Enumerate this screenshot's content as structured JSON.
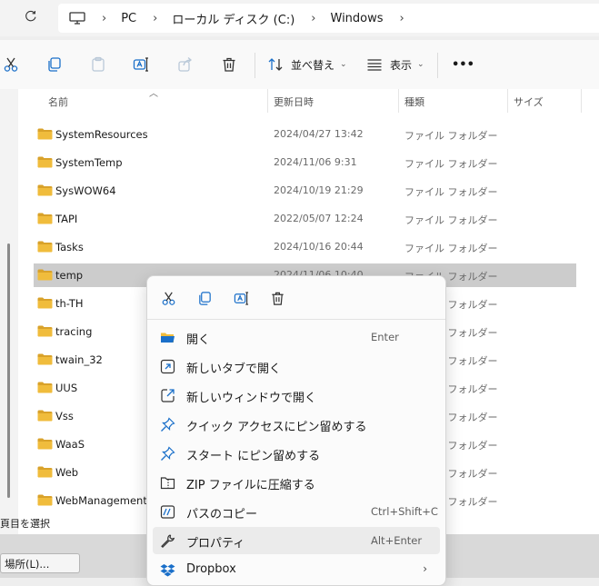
{
  "address": {
    "segments": [
      "PC",
      "ローカル ディスク (C:)",
      "Windows"
    ]
  },
  "toolbar": {
    "sort_label": "並べ替え",
    "view_label": "表示",
    "more_label": "•••"
  },
  "columns": {
    "name": "名前",
    "date": "更新日時",
    "type": "種類",
    "size": "サイズ"
  },
  "rows": [
    {
      "name": "SystemResources",
      "date": "2024/04/27 13:42",
      "type": "ファイル フォルダー"
    },
    {
      "name": "SystemTemp",
      "date": "2024/11/06 9:31",
      "type": "ファイル フォルダー"
    },
    {
      "name": "SysWOW64",
      "date": "2024/10/19 21:29",
      "type": "ファイル フォルダー"
    },
    {
      "name": "TAPI",
      "date": "2022/05/07 12:24",
      "type": "ファイル フォルダー"
    },
    {
      "name": "Tasks",
      "date": "2024/10/16 20:44",
      "type": "ファイル フォルダー"
    },
    {
      "name": "temp",
      "date": "2024/11/06 10:40",
      "type": "ファイル フォルダー"
    },
    {
      "name": "th-TH",
      "date": "",
      "type": "ファイル フォルダー"
    },
    {
      "name": "tracing",
      "date": "",
      "type": "ファイル フォルダー"
    },
    {
      "name": "twain_32",
      "date": "",
      "type": "ファイル フォルダー"
    },
    {
      "name": "UUS",
      "date": "",
      "type": "ファイル フォルダー"
    },
    {
      "name": "Vss",
      "date": "",
      "type": "ファイル フォルダー"
    },
    {
      "name": "WaaS",
      "date": "",
      "type": "ファイル フォルダー"
    },
    {
      "name": "Web",
      "date": "",
      "type": "ファイル フォルダー"
    },
    {
      "name": "WebManagement",
      "date": "",
      "type": "ファイル フォルダー"
    }
  ],
  "status": {
    "selection_text": "頁目を選択"
  },
  "location_button": "場所(L)...",
  "context_menu": {
    "items": [
      {
        "label": "開く",
        "shortcut": "Enter",
        "icon": "open-folder-icon"
      },
      {
        "label": "新しいタブで開く",
        "shortcut": "",
        "icon": "new-tab-icon"
      },
      {
        "label": "新しいウィンドウで開く",
        "shortcut": "",
        "icon": "new-window-icon"
      },
      {
        "label": "クイック アクセスにピン留めする",
        "shortcut": "",
        "icon": "pin-icon"
      },
      {
        "label": "スタート にピン留めする",
        "shortcut": "",
        "icon": "pin-icon"
      },
      {
        "label": "ZIP ファイルに圧縮する",
        "shortcut": "",
        "icon": "zip-icon"
      },
      {
        "label": "パスのコピー",
        "shortcut": "Ctrl+Shift+C",
        "icon": "copy-path-icon"
      },
      {
        "label": "プロパティ",
        "shortcut": "Alt+Enter",
        "icon": "wrench-icon"
      },
      {
        "label": "Dropbox",
        "shortcut": "",
        "icon": "dropbox-icon"
      }
    ]
  },
  "colors": {
    "folder": "#f0bc3c",
    "folder_dark": "#d9a22a",
    "selection": "#cccccc",
    "accent_blue": "#1a6fc9"
  }
}
